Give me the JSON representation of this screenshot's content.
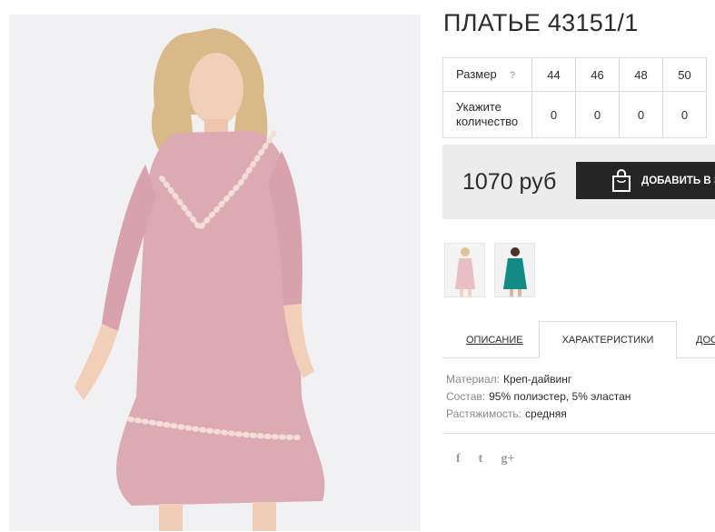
{
  "product": {
    "title": "ПЛАТЬЕ 43151/1"
  },
  "sizes": {
    "size_label": "Размер",
    "help_symbol": "?",
    "qty_label": "Укажите количество",
    "items": [
      {
        "size": "44",
        "qty": "0"
      },
      {
        "size": "46",
        "qty": "0"
      },
      {
        "size": "48",
        "qty": "0"
      },
      {
        "size": "50",
        "qty": "0"
      }
    ]
  },
  "purchase": {
    "price": "1070 руб",
    "cart_button_label": "ДОБАВИТЬ В З",
    "cart_icon": "shopping-bag-icon"
  },
  "gallery": {
    "thumbnails": [
      {
        "name": "pink-dress-thumbnail",
        "dress_color": "#dcaab2"
      },
      {
        "name": "teal-dress-thumbnail",
        "dress_color": "#138a86"
      }
    ]
  },
  "tabs": [
    {
      "label": "ОПИСАНИЕ"
    },
    {
      "label": "ХАРАКТЕРИСТИКИ",
      "active": true
    },
    {
      "label": "ДОС"
    }
  ],
  "specs": [
    {
      "key": "Материал:",
      "value": "Креп-дайвинг"
    },
    {
      "key": "Состав:",
      "value": "95% полиэстер, 5% эластан"
    },
    {
      "key": "Растяжимость:",
      "value": "средняя"
    }
  ],
  "social": [
    {
      "icon": "facebook-icon",
      "glyph": "f"
    },
    {
      "icon": "twitter-icon",
      "glyph": "t"
    },
    {
      "icon": "google-plus-icon",
      "glyph": "g+"
    }
  ],
  "colors": {
    "dress": "#dcaab2",
    "button_bg": "#252525",
    "price_bg": "#ececec"
  }
}
